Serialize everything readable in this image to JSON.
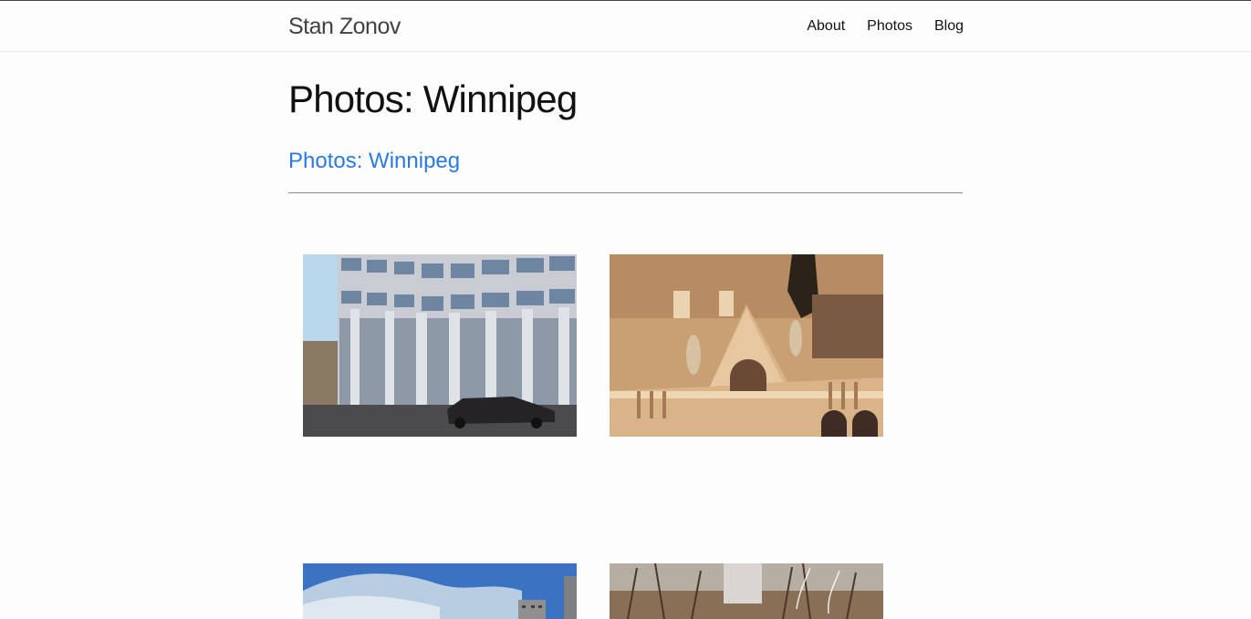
{
  "header": {
    "site_title": "Stan Zonov",
    "nav": [
      {
        "label": "About"
      },
      {
        "label": "Photos"
      },
      {
        "label": "Blog"
      }
    ]
  },
  "main": {
    "page_heading": "Photos: Winnipeg",
    "post_link": "Photos: Winnipeg"
  },
  "colors": {
    "link": "#2a7ae2",
    "text": "#111111",
    "header_title": "#424242",
    "background": "#fdfdfd"
  },
  "photos": [
    {
      "subject": "office-building-street-photo"
    },
    {
      "subject": "ornate-sandstone-building-photo"
    },
    {
      "subject": "sky-and-highrise-photo"
    },
    {
      "subject": "winter-trees-and-tower-photo"
    }
  ]
}
